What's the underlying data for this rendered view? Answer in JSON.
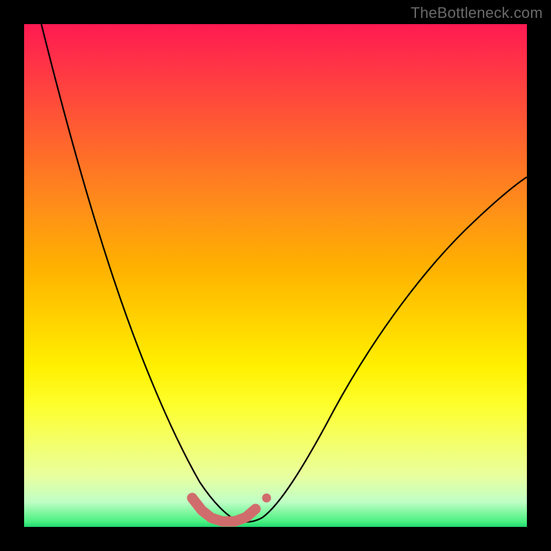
{
  "watermark": "TheBottleneck.com",
  "chart_data": {
    "type": "line",
    "title": "",
    "xlabel": "",
    "ylabel": "",
    "xlim": [
      0,
      100
    ],
    "ylim": [
      0,
      100
    ],
    "grid": false,
    "legend": false,
    "background_gradient": {
      "stops": [
        {
          "pos": 0.0,
          "color": "#ff1a52"
        },
        {
          "pos": 0.12,
          "color": "#ff4040"
        },
        {
          "pos": 0.25,
          "color": "#ff6a2a"
        },
        {
          "pos": 0.37,
          "color": "#ff9018"
        },
        {
          "pos": 0.48,
          "color": "#ffb000"
        },
        {
          "pos": 0.58,
          "color": "#ffd000"
        },
        {
          "pos": 0.68,
          "color": "#fff000"
        },
        {
          "pos": 0.76,
          "color": "#fdff2e"
        },
        {
          "pos": 0.83,
          "color": "#f4ff68"
        },
        {
          "pos": 0.9,
          "color": "#e8ffa0"
        },
        {
          "pos": 0.95,
          "color": "#c0ffc5"
        },
        {
          "pos": 0.99,
          "color": "#48f080"
        },
        {
          "pos": 1.0,
          "color": "#20d870"
        }
      ]
    },
    "series": [
      {
        "name": "bottleneck-curve",
        "color": "#000000",
        "x": [
          3.5,
          6,
          8,
          10,
          12,
          14,
          16,
          18,
          20,
          22,
          24,
          26,
          28,
          30,
          32,
          34,
          36,
          38,
          40,
          42,
          45,
          50,
          55,
          60,
          65,
          70,
          75,
          80,
          85,
          90,
          95,
          100
        ],
        "y": [
          100,
          91,
          82,
          74,
          67,
          60,
          53,
          47,
          41,
          36,
          31,
          26,
          22,
          18,
          14,
          11,
          8,
          5.5,
          3.5,
          2,
          1.3,
          3,
          8,
          15,
          23,
          31,
          39,
          46,
          53,
          59,
          64,
          68
        ]
      }
    ],
    "markers": [
      {
        "name": "optimal-region",
        "color": "#d16c6c",
        "x": [
          33,
          35,
          37,
          39,
          41,
          43,
          45,
          47
        ],
        "y": [
          5.5,
          3.2,
          1.3,
          0.8,
          0.8,
          1.3,
          2.8,
          5.5
        ]
      }
    ]
  }
}
